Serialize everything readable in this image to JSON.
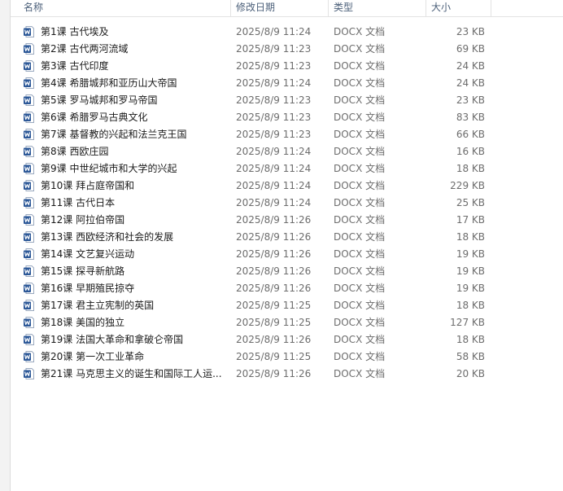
{
  "columns": {
    "name": "名称",
    "date": "修改日期",
    "type": "类型",
    "size": "大小"
  },
  "files": [
    {
      "name": "第1课 古代埃及",
      "date": "2025/8/9 11:24",
      "type": "DOCX 文档",
      "size": "23 KB"
    },
    {
      "name": "第2课 古代两河流域",
      "date": "2025/8/9 11:23",
      "type": "DOCX 文档",
      "size": "69 KB"
    },
    {
      "name": "第3课 古代印度",
      "date": "2025/8/9 11:23",
      "type": "DOCX 文档",
      "size": "24 KB"
    },
    {
      "name": "第4课 希腊城邦和亚历山大帝国",
      "date": "2025/8/9 11:24",
      "type": "DOCX 文档",
      "size": "24 KB"
    },
    {
      "name": "第5课 罗马城邦和罗马帝国",
      "date": "2025/8/9 11:23",
      "type": "DOCX 文档",
      "size": "23 KB"
    },
    {
      "name": "第6课 希腊罗马古典文化",
      "date": "2025/8/9 11:23",
      "type": "DOCX 文档",
      "size": "83 KB"
    },
    {
      "name": "第7课 基督教的兴起和法兰克王国",
      "date": "2025/8/9 11:23",
      "type": "DOCX 文档",
      "size": "66 KB"
    },
    {
      "name": "第8课 西欧庄园",
      "date": "2025/8/9 11:24",
      "type": "DOCX 文档",
      "size": "16 KB"
    },
    {
      "name": "第9课 中世纪城市和大学的兴起",
      "date": "2025/8/9 11:24",
      "type": "DOCX 文档",
      "size": "18 KB"
    },
    {
      "name": "第10课 拜占庭帝国和",
      "date": "2025/8/9 11:24",
      "type": "DOCX 文档",
      "size": "229 KB"
    },
    {
      "name": "第11课 古代日本",
      "date": "2025/8/9 11:24",
      "type": "DOCX 文档",
      "size": "25 KB"
    },
    {
      "name": "第12课 阿拉伯帝国",
      "date": "2025/8/9 11:26",
      "type": "DOCX 文档",
      "size": "17 KB"
    },
    {
      "name": "第13课 西欧经济和社会的发展",
      "date": "2025/8/9 11:26",
      "type": "DOCX 文档",
      "size": "18 KB"
    },
    {
      "name": "第14课 文艺复兴运动",
      "date": "2025/8/9 11:26",
      "type": "DOCX 文档",
      "size": "19 KB"
    },
    {
      "name": "第15课 探寻新航路",
      "date": "2025/8/9 11:26",
      "type": "DOCX 文档",
      "size": "19 KB"
    },
    {
      "name": "第16课 早期殖民掠夺",
      "date": "2025/8/9 11:26",
      "type": "DOCX 文档",
      "size": "19 KB"
    },
    {
      "name": "第17课 君主立宪制的英国",
      "date": "2025/8/9 11:25",
      "type": "DOCX 文档",
      "size": "18 KB"
    },
    {
      "name": "第18课 美国的独立",
      "date": "2025/8/9 11:25",
      "type": "DOCX 文档",
      "size": "127 KB"
    },
    {
      "name": "第19课 法国大革命和拿破仑帝国",
      "date": "2025/8/9 11:26",
      "type": "DOCX 文档",
      "size": "18 KB"
    },
    {
      "name": "第20课 第一次工业革命",
      "date": "2025/8/9 11:25",
      "type": "DOCX 文档",
      "size": "58 KB"
    },
    {
      "name": "第21课 马克思主义的诞生和国际工人运...",
      "date": "2025/8/9 11:26",
      "type": "DOCX 文档",
      "size": "20 KB"
    }
  ],
  "icon": "word-document-icon",
  "colors": {
    "header_text": "#4c607a",
    "icon_blue": "#2b5797",
    "meta_text": "#6d6d6d"
  }
}
